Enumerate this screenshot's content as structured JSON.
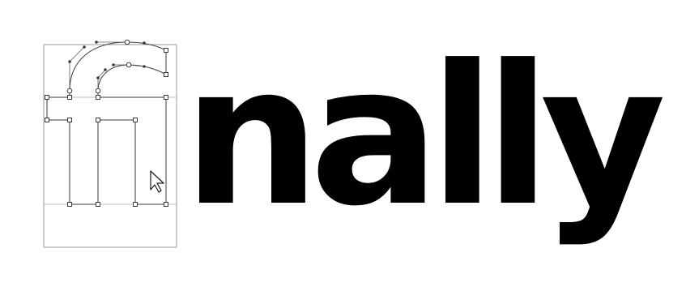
{
  "word": {
    "full_text": "finally",
    "ligature_outline": "fi",
    "rendered_text": "nally"
  },
  "colors": {
    "text": "#000000",
    "outline": "#3a3a3a",
    "guides": "#9a9a9a",
    "background": "#ffffff"
  },
  "icons": {
    "cursor": "arrow-pointer-icon"
  }
}
